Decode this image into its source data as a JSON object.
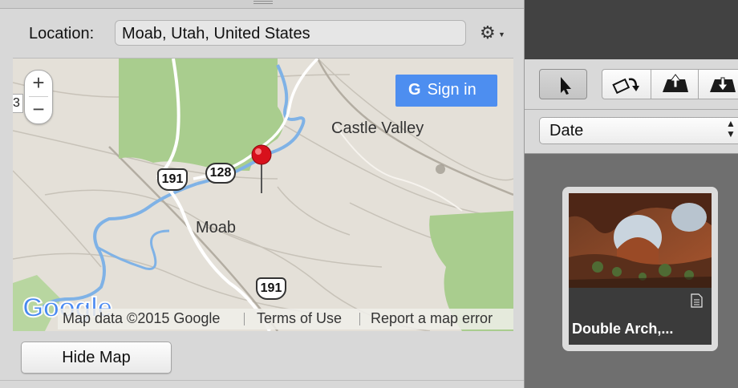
{
  "location": {
    "label": "Location:",
    "value": "Moab, Utah, United States",
    "action_icon": "gear-icon"
  },
  "map": {
    "zoom_in_label": "+",
    "zoom_out_label": "−",
    "edge_marker_label": "3",
    "sign_in_label": "Sign in",
    "sign_in_icon": "google-g-icon",
    "places": {
      "castle_valley": "Castle Valley",
      "moab": "Moab"
    },
    "routes": {
      "us_191_north": "191",
      "state_128": "128",
      "us_191_south": "191"
    },
    "logo_text": "Google",
    "attribution": {
      "map_data": "Map data ©2015 Google",
      "terms": "Terms of Use",
      "report": "Report a map error"
    },
    "colors": {
      "terrain": "#e4e0d8",
      "forest": "#a9cd8e",
      "river": "#7fb2e6",
      "pin": "#d8111c"
    }
  },
  "hide_map_label": "Hide Map",
  "toolbar": {
    "tools": [
      "pointer-icon",
      "rotate-icon",
      "zoom-in-icon",
      "zoom-out-icon"
    ],
    "sort_value": "Date"
  },
  "browser": {
    "items": [
      {
        "caption": "Double Arch,...",
        "badge_icon": "file-badge-icon"
      }
    ]
  },
  "colors": {
    "accent": "#4d8ef0",
    "panel_dark": "#424242",
    "browser_bg": "#6f6f6f"
  }
}
